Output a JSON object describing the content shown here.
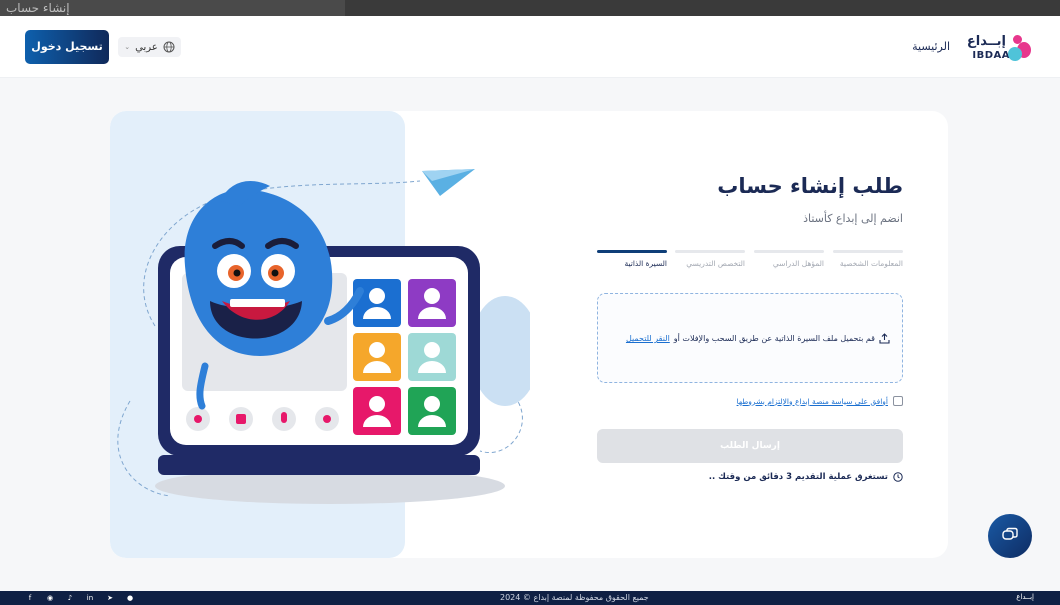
{
  "window": {
    "tab_title": "إنشاء حساب"
  },
  "header": {
    "logo_ar": "إبــداع",
    "logo_en": "IBDAA",
    "nav_home": "الرئيسية",
    "language": "عربي",
    "login_button": "تسجيل دخول"
  },
  "form": {
    "title": "طلب إنشاء حساب",
    "subtitle": "انضم إلى إبداع كأستاذ",
    "steps": [
      {
        "label": "المعلومات الشخصية",
        "active": false
      },
      {
        "label": "المؤهل الدراسي",
        "active": false
      },
      {
        "label": "التخصص التدريسي",
        "active": false
      },
      {
        "label": "السيرة الذاتية",
        "active": true
      }
    ],
    "upload_text": "قم بتحميل ملف السيرة الذاتية عن طريق السحب والإفلات أو",
    "upload_link": "النقر للتحميل",
    "agree_text": "أوافق على سياسة منصة إبداع والإلتزام بشروطها",
    "submit_button": "إرسال الطلب",
    "timing_note": "تستغرق عملية التقديم 3 دقائق من وقتك .."
  },
  "footer": {
    "copyright": "جميع الحقوق محفوظة لمنصة إبداع © 2024",
    "socials": [
      "facebook-icon",
      "instagram-icon",
      "tiktok-icon",
      "linkedin-icon",
      "telegram-icon",
      "whatsapp-icon"
    ]
  },
  "colors": {
    "brand_dark": "#10295a",
    "brand_blue": "#0e60ad",
    "accent_pink": "#e7378d",
    "accent_cyan": "#4fc3d9"
  }
}
